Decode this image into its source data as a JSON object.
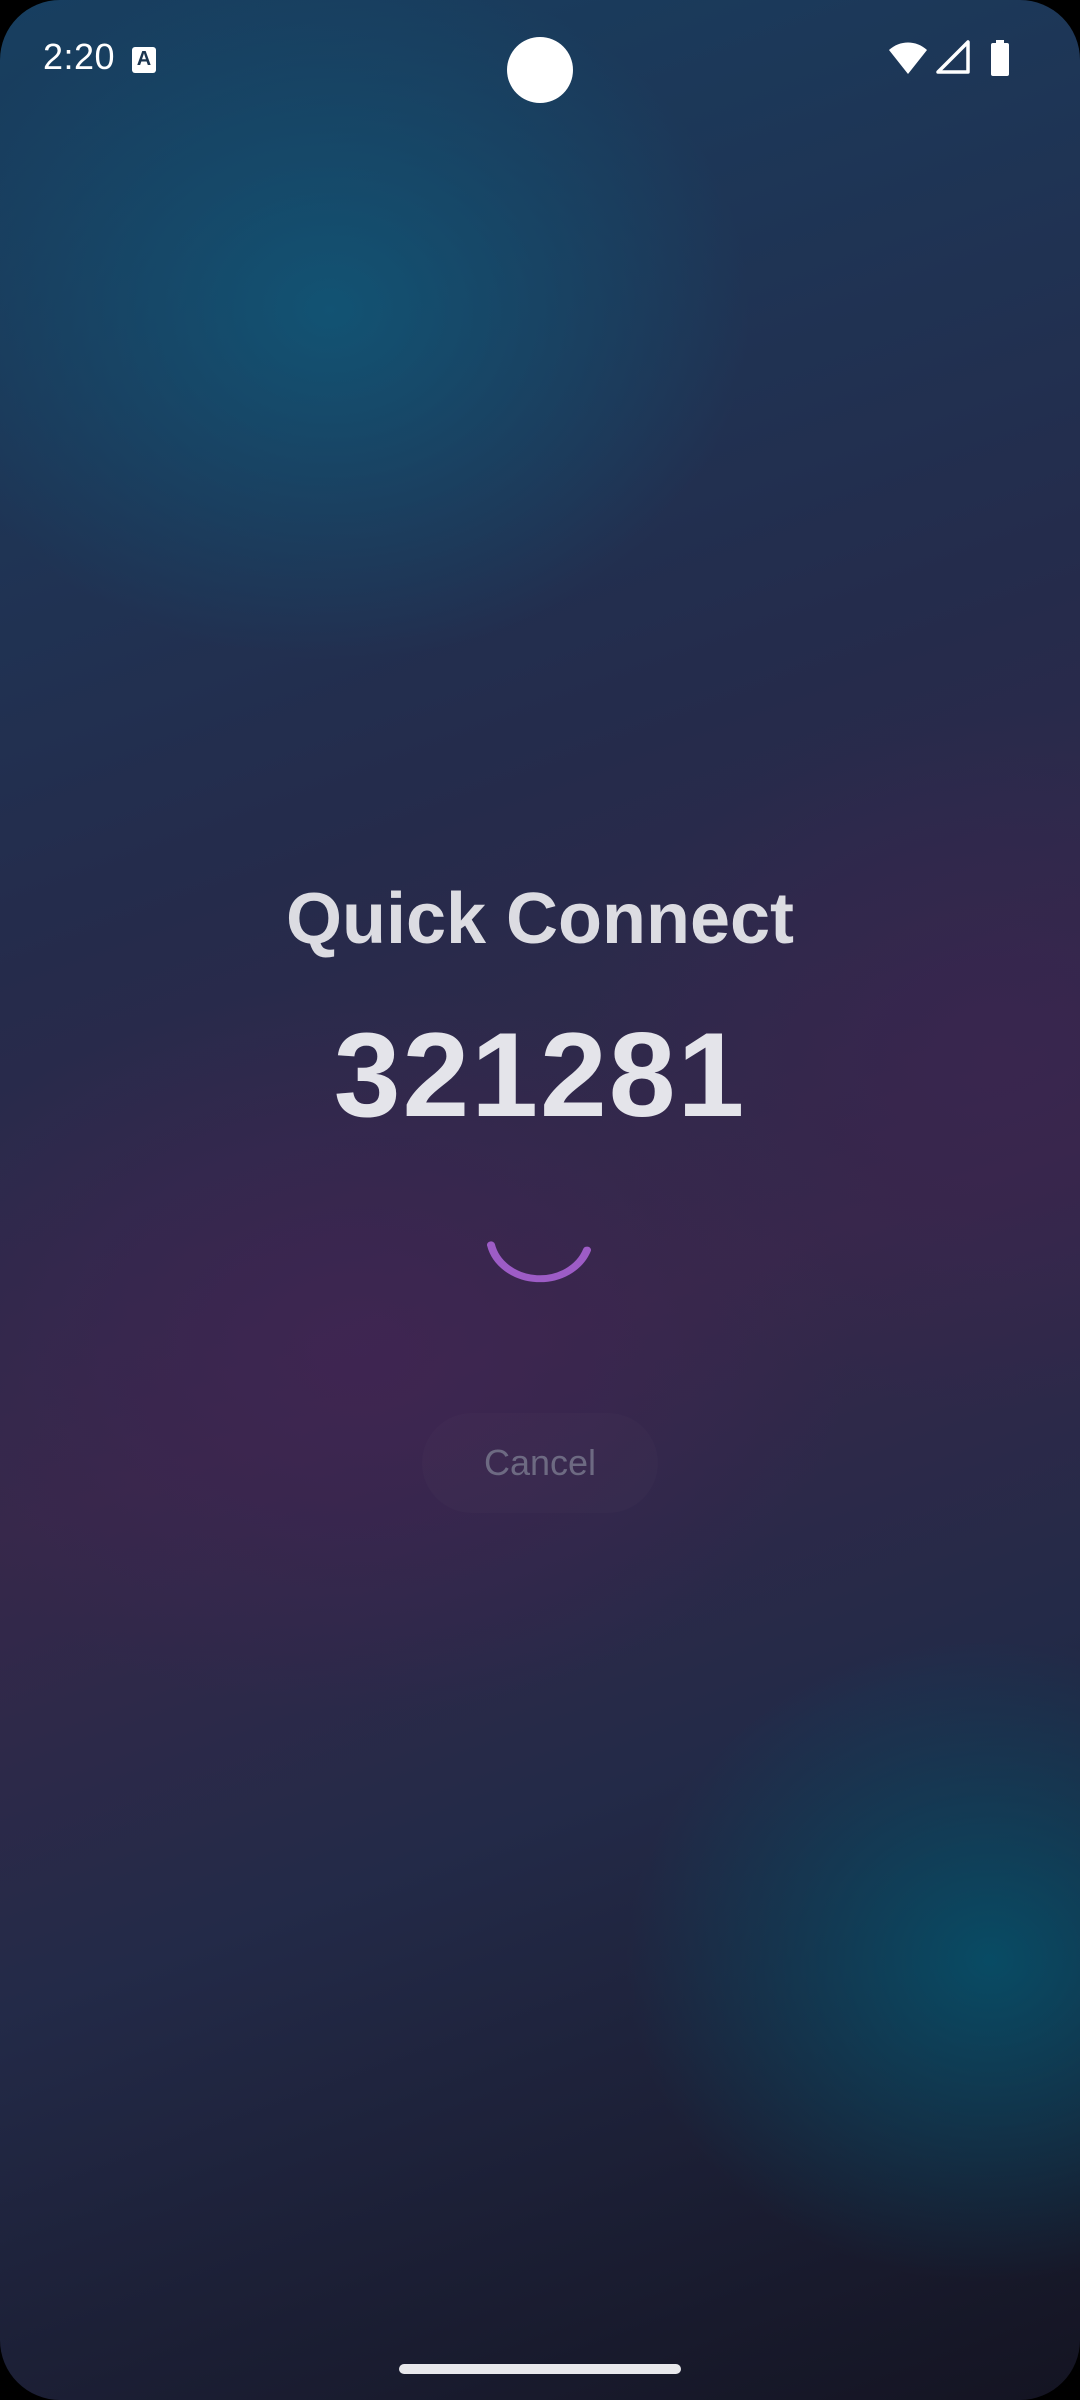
{
  "status_bar": {
    "time": "2:20",
    "notification_icon": "text-a-icon",
    "notification_glyph": "A",
    "icons": [
      "wifi-icon",
      "cellular-signal-icon",
      "battery-icon"
    ]
  },
  "main": {
    "title": "Quick Connect",
    "code": "321281",
    "loading_indicator": "spinner-icon",
    "cancel_label": "Cancel"
  },
  "colors": {
    "spinner": "#9d5cc6",
    "title_text": "#dcdce2",
    "cancel_text": "#6d6a82"
  }
}
